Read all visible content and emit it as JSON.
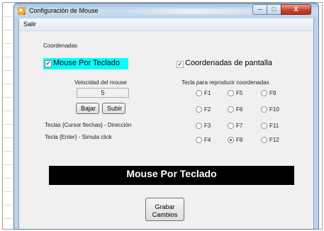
{
  "window": {
    "title": "Configuración de Mouse",
    "buttons": {
      "minimize": "─",
      "maximize": "□",
      "close": "X"
    }
  },
  "menu": {
    "salir": "Salir"
  },
  "main": {
    "section_label": "Coordenadas",
    "mouse_por_teclado_checkbox": {
      "label": "Mouse Por Teclado",
      "checked": true,
      "highlight": "#00ffff"
    },
    "coordenadas_pantalla_checkbox": {
      "label": "Coordenadas de pantalla",
      "checked": true
    },
    "velocidad_label": "Velocidad del mouse",
    "velocidad_value": "5",
    "bajar_button": "Bajar",
    "subir_button": "Subir",
    "hint_direccion": "Teclas {Cursor flechas} - Dirección",
    "hint_click": "Tecla  {Enter} - Simula click",
    "tecla_label": "Tecla para reproducir coordenadas",
    "function_keys": [
      {
        "label": "F1",
        "checked": false
      },
      {
        "label": "F5",
        "checked": false
      },
      {
        "label": "F9",
        "checked": false
      },
      {
        "label": "F2",
        "checked": false
      },
      {
        "label": "F6",
        "checked": false
      },
      {
        "label": "F10",
        "checked": false
      },
      {
        "label": "F3",
        "checked": false
      },
      {
        "label": "F7",
        "checked": false
      },
      {
        "label": "F11",
        "checked": false
      },
      {
        "label": "F4",
        "checked": false
      },
      {
        "label": "F8",
        "checked": true
      },
      {
        "label": "F12",
        "checked": false
      }
    ],
    "banner_text": "Mouse Por Teclado",
    "grabar_line1": "Grabar",
    "grabar_line2": "Cambios"
  },
  "colors": {
    "banner_bg": "#000000",
    "banner_fg": "#ffffff",
    "highlight": "#00ffff"
  }
}
